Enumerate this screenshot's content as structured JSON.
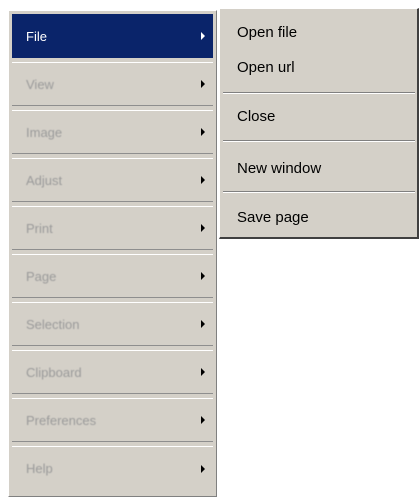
{
  "main_menu": {
    "items": [
      {
        "label": "File",
        "active": true
      },
      {
        "label": "View"
      },
      {
        "label": "Image"
      },
      {
        "label": "Adjust"
      },
      {
        "label": "Print"
      },
      {
        "label": "Page"
      },
      {
        "label": "Selection"
      },
      {
        "label": "Clipboard"
      },
      {
        "label": "Preferences"
      },
      {
        "label": "Help"
      }
    ]
  },
  "submenu": {
    "items": [
      {
        "label": "Open file"
      },
      {
        "label": "Open url"
      },
      {
        "label": "Close"
      },
      {
        "label": "New window"
      },
      {
        "label": "Save page"
      }
    ]
  },
  "colors": {
    "menu_bg": "#d4d0c8",
    "highlight": "#0a246a",
    "highlight_text": "#ffffff"
  },
  "icons": {
    "submenu_arrow": "triangle-right"
  }
}
